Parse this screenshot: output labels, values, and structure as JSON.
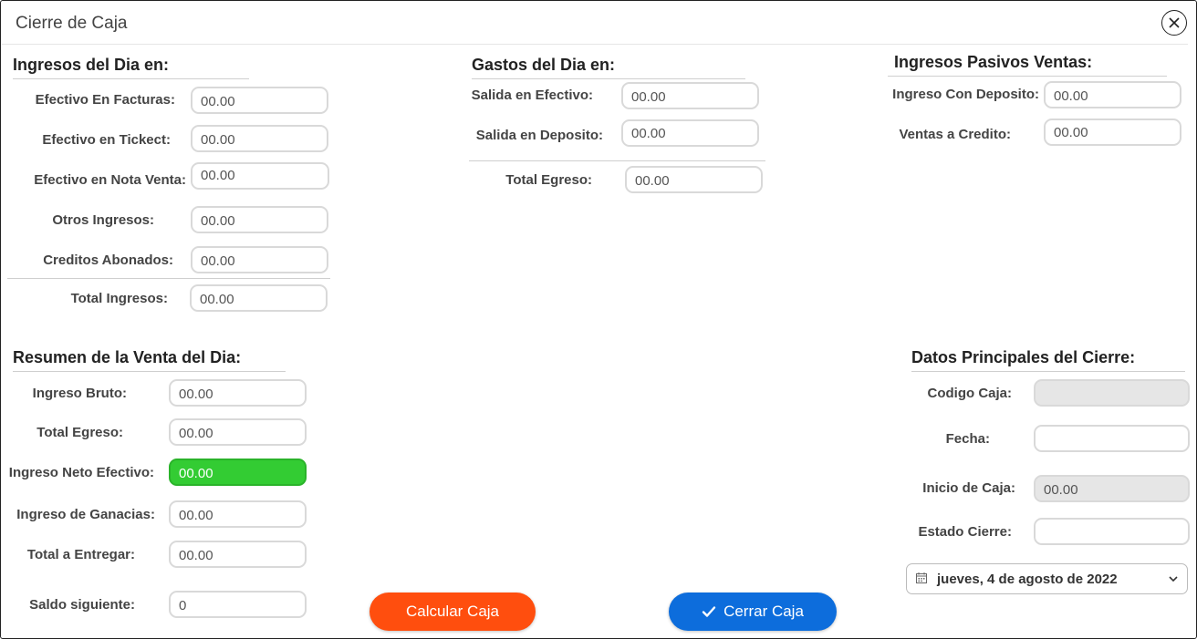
{
  "window": {
    "title": "Cierre de Caja"
  },
  "ingresos": {
    "title": "Ingresos del Dia en:",
    "fields": [
      {
        "label": "Efectivo En Facturas:",
        "value": "00.00"
      },
      {
        "label": "Efectivo en Tickect:",
        "value": "00.00"
      },
      {
        "label": "Efectivo en Nota Venta:",
        "value": "00.00"
      },
      {
        "label": "Otros Ingresos:",
        "value": "00.00"
      },
      {
        "label": "Creditos Abonados:",
        "value": "00.00"
      }
    ],
    "total": {
      "label": "Total Ingresos:",
      "value": "00.00"
    }
  },
  "gastos": {
    "title": "Gastos del Dia en:",
    "fields": [
      {
        "label": "Salida en Efectivo:",
        "value": "00.00"
      },
      {
        "label": "Salida en Deposito:",
        "value": "00.00"
      }
    ],
    "total": {
      "label": "Total Egreso:",
      "value": "00.00"
    }
  },
  "pasivos": {
    "title": "Ingresos Pasivos Ventas:",
    "fields": [
      {
        "label": "Ingreso Con Deposito:",
        "value": "00.00"
      },
      {
        "label": "Ventas a Credito:",
        "value": "00.00"
      }
    ]
  },
  "resumen": {
    "title": "Resumen de la Venta del Dia:",
    "fields": [
      {
        "label": "Ingreso Bruto:",
        "value": "00.00"
      },
      {
        "label": "Total Egreso:",
        "value": "00.00"
      },
      {
        "label": "Ingreso Neto Efectivo:",
        "value": "00.00"
      },
      {
        "label": "Ingreso de Ganacias:",
        "value": "00.00"
      },
      {
        "label": "Total a Entregar:",
        "value": "00.00"
      },
      {
        "label": "Saldo siguiente:",
        "value": "0"
      }
    ]
  },
  "datos": {
    "title": "Datos Principales del Cierre:",
    "fields": [
      {
        "label": "Codigo Caja:",
        "value": ""
      },
      {
        "label": "Fecha:",
        "value": ""
      },
      {
        "label": "Inicio de Caja:",
        "value": "00.00"
      },
      {
        "label": "Estado Cierre:",
        "value": ""
      }
    ],
    "date_select": "jueves, 4 de agosto de 2022"
  },
  "buttons": {
    "calcular": "Calcular Caja",
    "cerrar": "Cerrar Caja"
  },
  "icons": {
    "close": "close-icon",
    "calendar": "calendar-icon",
    "chevron": "chevron-down-icon",
    "check": "check-icon"
  },
  "colors": {
    "accent_orange": "#ff4e0e",
    "accent_blue": "#0d6ddc",
    "highlight_green": "#33cc33"
  }
}
